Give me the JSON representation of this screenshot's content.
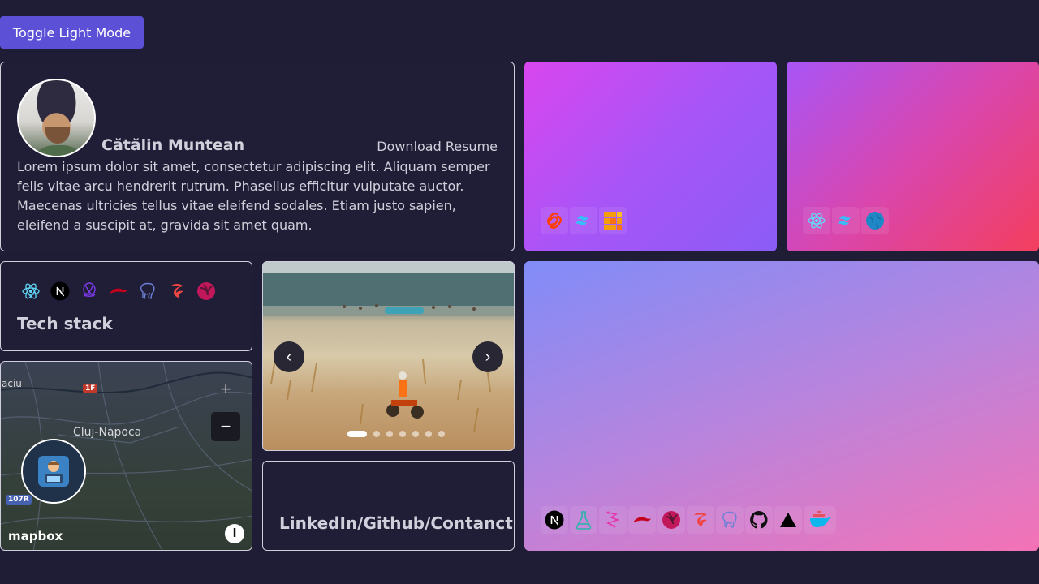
{
  "toggle": {
    "label": "Toggle Light Mode"
  },
  "profile": {
    "name": "Cătălin Muntean",
    "resume_label": "Download Resume",
    "bio": "Lorem ipsum dolor sit amet, consectetur adipiscing elit. Aliquam semper felis vitae arcu hendrerit rutrum. Phasellus efficitur vulputate auctor. Maecenas ultricies tellus vitae eleifend sodales. Etiam justo sapien, eleifend a suscipit at, gravida sit amet quam."
  },
  "projects": [
    {
      "icons": [
        "svelte-icon",
        "tailwind-icon",
        "grid-icon"
      ],
      "colors": [
        "#d946ef",
        "#8b5cf6"
      ]
    },
    {
      "icons": [
        "react-icon",
        "tailwind-icon",
        "globe-icon"
      ],
      "colors": [
        "#a855f7",
        "#f43f5e"
      ]
    },
    {
      "icons": [
        "nextjs-icon",
        "flask-icon",
        "graphql-icon",
        "nestjs-icon",
        "rxjs-icon",
        "turborepo-icon",
        "postgresql-icon",
        "github-icon",
        "vercel-icon",
        "docker-icon"
      ],
      "colors": [
        "#818cf8",
        "#f472b6"
      ]
    }
  ],
  "tech": {
    "title": "Tech stack",
    "icons": [
      "react-icon",
      "nextjs-icon",
      "graphql-icon",
      "nestjs-icon",
      "postgresql-icon",
      "turborepo-icon",
      "rxjs-icon"
    ]
  },
  "map": {
    "city": "Cluj-Napoca",
    "partial_label": "aciu",
    "road_1": "1F",
    "road_2": "107R",
    "zoom_in": "+",
    "zoom_out": "−",
    "logo": "mapbox",
    "info": "i"
  },
  "photo": {
    "slide_count": 7,
    "active_slide": 1,
    "prev": "‹",
    "next": "›"
  },
  "social": {
    "title": "LinkedIn/Github/Contanct"
  }
}
